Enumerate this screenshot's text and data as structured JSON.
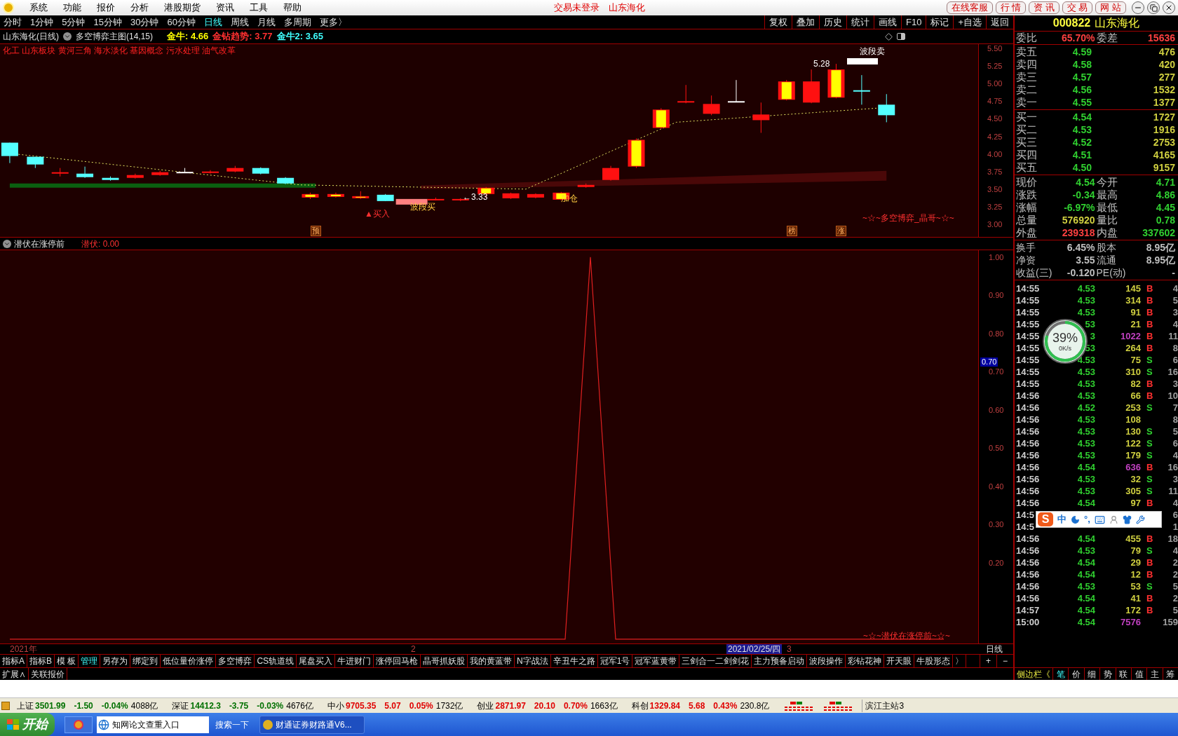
{
  "menu": {
    "items": [
      "系统",
      "功能",
      "报价",
      "分析",
      "港股期货",
      "资讯",
      "工具",
      "帮助"
    ],
    "status": "交易未登录",
    "title": "山东海化",
    "buttons": [
      "在线客服",
      "行 情",
      "资 讯",
      "交 易",
      "网 站"
    ]
  },
  "periods": [
    {
      "label": "分时",
      "selected": false
    },
    {
      "label": "1分钟",
      "selected": false
    },
    {
      "label": "5分钟",
      "selected": false
    },
    {
      "label": "15分钟",
      "selected": false
    },
    {
      "label": "30分钟",
      "selected": false
    },
    {
      "label": "60分钟",
      "selected": false
    },
    {
      "label": "日线",
      "selected": true
    },
    {
      "label": "周线",
      "selected": false
    },
    {
      "label": "月线",
      "selected": false
    },
    {
      "label": "多周期",
      "selected": false
    },
    {
      "label": "更多〉",
      "selected": false
    }
  ],
  "tools": [
    "复权",
    "叠加",
    "历史",
    "统计",
    "画线",
    "F10",
    "标记",
    "+自选",
    "返回"
  ],
  "chart_header": {
    "title": "山东海化(日线)",
    "formula": "多空博弈主图(14,15)",
    "indicators": [
      {
        "label": "金牛: 4.66",
        "color": "#ffff00"
      },
      {
        "label": "金钻趋势: 3.77",
        "color": "#ff3030"
      },
      {
        "label": "金牛2: 3.65",
        "color": "#40ffff"
      }
    ]
  },
  "concepts": "化工 山东板块 黄河三角 海水淡化 基因概念 污水处理 油气改革",
  "price_axis": [
    "5.50",
    "5.25",
    "5.00",
    "4.75",
    "4.50",
    "4.25",
    "4.00",
    "3.75",
    "3.50",
    "3.25",
    "3.00"
  ],
  "annotations": [
    "波段卖",
    "5.28",
    "▲买入",
    "波段买",
    "←3.33",
    "加仓",
    "~☆~多空博弈_晶哥~☆~"
  ],
  "markers": [
    "预",
    "榜",
    "涨"
  ],
  "indicator": {
    "title": "潜伏在涨停前",
    "reading": "潜伏: 0.00",
    "footer": "~☆~潜伏在涨停前~☆~",
    "cursor_value": "0.70",
    "chart_data": {
      "type": "line",
      "ylim": [
        -0.013,
        1.018
      ],
      "yticks": [
        {
          "value": 1,
          "label": "1.00"
        },
        {
          "value": 0.9,
          "label": "0.90"
        },
        {
          "value": 0.8,
          "label": "0.80"
        },
        {
          "value": 0.7,
          "label": "0.70"
        },
        {
          "value": 0.6,
          "label": "0.60"
        },
        {
          "value": 0.5,
          "label": "0.50"
        },
        {
          "value": 0.4,
          "label": "0.40"
        },
        {
          "value": 0.3,
          "label": "0.30"
        },
        {
          "value": 0.2,
          "label": "0.20"
        }
      ],
      "series": [
        {
          "color": "#e02020",
          "values": [
            0,
            0,
            0,
            0,
            0,
            0,
            0,
            0,
            0,
            0,
            0,
            0,
            0,
            0,
            0,
            0,
            0,
            0,
            0,
            0,
            0,
            0,
            0,
            1,
            0,
            0,
            0,
            0,
            0,
            0,
            0,
            0,
            0,
            0,
            0,
            0,
            0,
            0
          ]
        }
      ]
    }
  },
  "date_axis": {
    "year": "2021年",
    "month_2": "2",
    "cursor_date": "2021/02/25/四",
    "month_3": "3",
    "period": "日线"
  },
  "tabs": [
    {
      "label": "指标A",
      "selected": false
    },
    {
      "label": "指标B",
      "selected": false
    },
    {
      "label": "模 板",
      "selected": false
    },
    {
      "label": "管理",
      "selected": true
    },
    {
      "label": "另存为",
      "selected": false
    },
    {
      "label": "绑定到",
      "selected": false
    },
    {
      "label": "低位量价涨停",
      "selected": false
    },
    {
      "label": "多空博弈",
      "selected": false
    },
    {
      "label": "CS轨道线",
      "selected": false
    },
    {
      "label": "尾盘买入",
      "selected": false
    },
    {
      "label": "牛进财门",
      "selected": false
    },
    {
      "label": "涨停回马枪",
      "selected": false
    },
    {
      "label": "晶哥抓妖股",
      "selected": false
    },
    {
      "label": "我的黄蓝带",
      "selected": false
    },
    {
      "label": "N字战法",
      "selected": false
    },
    {
      "label": "辛丑牛之路",
      "selected": false
    },
    {
      "label": "冠军1号",
      "selected": false
    },
    {
      "label": "冠军蓝黄带",
      "selected": false
    },
    {
      "label": "三剑合一二剑剑花",
      "selected": false
    },
    {
      "label": "主力预备启动",
      "selected": false
    },
    {
      "label": "波段操作",
      "selected": false
    },
    {
      "label": "彩钻花神",
      "selected": false
    },
    {
      "label": "开天眼",
      "selected": false
    },
    {
      "label": "牛股形态",
      "selected": false
    },
    {
      "label": "〉",
      "selected": false
    }
  ],
  "tab_controls": [
    "+",
    "−"
  ],
  "extra_tabs": [
    "扩展∧",
    "关联报价"
  ],
  "quote": {
    "code": "000822",
    "name": "山东海化",
    "ratio": [
      {
        "label": "委比",
        "value": "65.70%",
        "color": "#ff4040"
      },
      {
        "label": "委差",
        "value": "15636",
        "color": "#ff4040"
      }
    ],
    "asks": [
      {
        "label": "卖五",
        "price": "4.59",
        "volume": "476"
      },
      {
        "label": "卖四",
        "price": "4.58",
        "volume": "420"
      },
      {
        "label": "卖三",
        "price": "4.57",
        "volume": "277"
      },
      {
        "label": "卖二",
        "price": "4.56",
        "volume": "1532"
      },
      {
        "label": "卖一",
        "price": "4.55",
        "volume": "1377"
      }
    ],
    "bids": [
      {
        "label": "买一",
        "price": "4.54",
        "volume": "1727"
      },
      {
        "label": "买二",
        "price": "4.53",
        "volume": "1916"
      },
      {
        "label": "买三",
        "price": "4.52",
        "volume": "2753"
      },
      {
        "label": "买四",
        "price": "4.51",
        "volume": "4165"
      },
      {
        "label": "买五",
        "price": "4.50",
        "volume": "9157"
      }
    ],
    "stats": [
      [
        {
          "label": "现价",
          "value": "4.54",
          "color": "#30d030"
        },
        {
          "label": "今开",
          "value": "4.71",
          "color": "#30d030"
        }
      ],
      [
        {
          "label": "涨跌",
          "value": "-0.34",
          "color": "#30d030"
        },
        {
          "label": "最高",
          "value": "4.86",
          "color": "#30d030"
        }
      ],
      [
        {
          "label": "涨幅",
          "value": "-6.97%",
          "color": "#30d030"
        },
        {
          "label": "最低",
          "value": "4.45",
          "color": "#30d030"
        }
      ],
      [
        {
          "label": "总量",
          "value": "576920",
          "color": "#d0d040"
        },
        {
          "label": "量比",
          "value": "0.78",
          "color": "#30d030"
        }
      ],
      [
        {
          "label": "外盘",
          "value": "239318",
          "color": "#ff4040"
        },
        {
          "label": "内盘",
          "value": "337602",
          "color": "#30d030"
        }
      ]
    ],
    "fundamentals": [
      [
        {
          "label": "换手",
          "value": "6.45%"
        },
        {
          "label": "股本",
          "value": "8.95亿"
        }
      ],
      [
        {
          "label": "净资",
          "value": "3.55"
        },
        {
          "label": "流通",
          "value": "8.95亿"
        }
      ],
      [
        {
          "label": "收益(三)",
          "value": "-0.120"
        },
        {
          "label": "PE(动)",
          "value": "-"
        }
      ]
    ]
  },
  "ticks": [
    {
      "time": "14:55",
      "price": "4.53",
      "volume": "145",
      "side": "B",
      "count": "4",
      "buy": true,
      "big": false
    },
    {
      "time": "14:55",
      "price": "4.53",
      "volume": "314",
      "side": "B",
      "count": "5",
      "buy": true,
      "big": false
    },
    {
      "time": "14:55",
      "price": "4.53",
      "volume": "91",
      "side": "B",
      "count": "3",
      "buy": true,
      "big": false
    },
    {
      "time": "14:55",
      "price": "53",
      "volume": "21",
      "side": "B",
      "count": "4",
      "buy": true,
      "big": false
    },
    {
      "time": "14:55",
      "price": "3",
      "volume": "1022",
      "side": "B",
      "count": "11",
      "buy": true,
      "big": true
    },
    {
      "time": "14:55",
      "price": "53",
      "volume": "264",
      "side": "B",
      "count": "8",
      "buy": true,
      "big": false
    },
    {
      "time": "14:55",
      "price": "4.53",
      "volume": "75",
      "side": "S",
      "count": "6",
      "buy": false,
      "big": false
    },
    {
      "time": "14:55",
      "price": "4.53",
      "volume": "310",
      "side": "S",
      "count": "16",
      "buy": false,
      "big": false
    },
    {
      "time": "14:55",
      "price": "4.53",
      "volume": "82",
      "side": "B",
      "count": "3",
      "buy": true,
      "big": false
    },
    {
      "time": "14:56",
      "price": "4.53",
      "volume": "66",
      "side": "B",
      "count": "10",
      "buy": true,
      "big": false
    },
    {
      "time": "14:56",
      "price": "4.52",
      "volume": "253",
      "side": "S",
      "count": "7",
      "buy": false,
      "big": false
    },
    {
      "time": "14:56",
      "price": "4.53",
      "volume": "108",
      "count": "8",
      "big": false
    },
    {
      "time": "14:56",
      "price": "4.53",
      "volume": "130",
      "side": "S",
      "count": "5",
      "buy": false,
      "big": false
    },
    {
      "time": "14:56",
      "price": "4.53",
      "volume": "122",
      "side": "S",
      "count": "6",
      "buy": false,
      "big": false
    },
    {
      "time": "14:56",
      "price": "4.53",
      "volume": "179",
      "side": "S",
      "count": "4",
      "buy": false,
      "big": false
    },
    {
      "time": "14:56",
      "price": "4.54",
      "volume": "636",
      "side": "B",
      "count": "16",
      "buy": true,
      "big": true
    },
    {
      "time": "14:56",
      "price": "4.53",
      "volume": "32",
      "side": "S",
      "count": "3",
      "buy": false,
      "big": false
    },
    {
      "time": "14:56",
      "price": "4.53",
      "volume": "305",
      "side": "S",
      "count": "11",
      "buy": false,
      "big": false
    },
    {
      "time": "14:56",
      "price": "4.54",
      "volume": "97",
      "side": "B",
      "count": "4",
      "buy": true,
      "big": false
    },
    {
      "time": "14:5",
      "count": "6"
    },
    {
      "time": "14:5",
      "count": "1"
    },
    {
      "time": "14:56",
      "price": "4.54",
      "volume": "455",
      "side": "B",
      "count": "18",
      "buy": true,
      "big": false
    },
    {
      "time": "14:56",
      "price": "4.53",
      "volume": "79",
      "side": "S",
      "count": "4",
      "buy": false,
      "big": false
    },
    {
      "time": "14:56",
      "price": "4.54",
      "volume": "29",
      "side": "B",
      "count": "2",
      "buy": true,
      "big": false
    },
    {
      "time": "14:56",
      "price": "4.54",
      "volume": "12",
      "side": "B",
      "count": "2",
      "buy": true,
      "big": false
    },
    {
      "time": "14:56",
      "price": "4.53",
      "volume": "53",
      "side": "S",
      "count": "5",
      "buy": false,
      "big": false
    },
    {
      "time": "14:56",
      "price": "4.54",
      "volume": "41",
      "side": "B",
      "count": "2",
      "buy": true,
      "big": false
    },
    {
      "time": "14:57",
      "price": "4.54",
      "volume": "172",
      "side": "B",
      "count": "5",
      "buy": true,
      "big": false
    },
    {
      "time": "15:00",
      "price": "4.54",
      "volume": "7576",
      "count": "159",
      "big": true
    }
  ],
  "network_meter": {
    "percent": "39%",
    "speed": "0K/s"
  },
  "ime_toolbar": {
    "logo": "S",
    "mode": "中",
    "punctuation": "°,"
  },
  "side_panel": {
    "toggle": "侧边栏《",
    "tabs": [
      {
        "label": "笔",
        "selected": true
      },
      {
        "label": "价",
        "selected": false
      },
      {
        "label": "细",
        "selected": false
      },
      {
        "label": "势",
        "selected": false
      },
      {
        "label": "联",
        "selected": false
      },
      {
        "label": "值",
        "selected": false
      },
      {
        "label": "主",
        "selected": false
      },
      {
        "label": "筹",
        "selected": false
      }
    ]
  },
  "indices": [
    {
      "name": "上证",
      "value": "3501.99",
      "change": "-1.50",
      "percent": "-0.04%",
      "amount": "4088亿",
      "up": false
    },
    {
      "name": "深证",
      "value": "14412.3",
      "change": "-3.75",
      "percent": "-0.03%",
      "amount": "4676亿",
      "up": false
    },
    {
      "name": "中小",
      "value": "9705.35",
      "change": "5.07",
      "percent": "0.05%",
      "amount": "1732亿",
      "up": true
    },
    {
      "name": "创业",
      "value": "2871.97",
      "change": "20.10",
      "percent": "0.70%",
      "amount": "1663亿",
      "up": true
    },
    {
      "name": "科创",
      "value": "1329.84",
      "change": "5.68",
      "percent": "0.43%",
      "amount": "230.8亿",
      "up": true
    }
  ],
  "server": "滨江主站3",
  "taskbar": {
    "start": "开始",
    "address": "知网论文查重入口",
    "search": "搜索一下",
    "task": "财通证券财路通V6..."
  }
}
